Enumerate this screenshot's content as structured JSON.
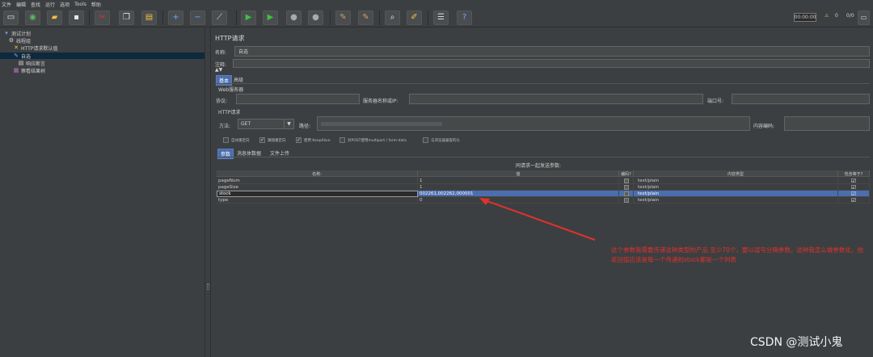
{
  "menu": [
    "文件",
    "编辑",
    "查找",
    "运行",
    "选项",
    "Tools",
    "帮助"
  ],
  "toolbar": {
    "buttons": [
      {
        "name": "new-icon",
        "glyph": "▭",
        "color": "#e8e8e8"
      },
      {
        "name": "templates-icon",
        "glyph": "◉",
        "color": "#5cb85c"
      },
      {
        "name": "open-icon",
        "glyph": "▰",
        "color": "#f0c040"
      },
      {
        "name": "save-icon",
        "glyph": "▪",
        "color": "#e8e8e8"
      },
      {
        "name": "cut-icon",
        "glyph": "✂",
        "color": "#e0322c"
      },
      {
        "name": "copy-icon",
        "glyph": "❐",
        "color": "#e8e8e8"
      },
      {
        "name": "paste-icon",
        "glyph": "▤",
        "color": "#f0c040"
      },
      {
        "name": "expand-icon",
        "glyph": "+",
        "color": "#6aa6ff"
      },
      {
        "name": "collapse-icon",
        "glyph": "−",
        "color": "#6aa6ff"
      },
      {
        "name": "toggle-icon",
        "glyph": "⟋",
        "color": "#dddddd"
      },
      {
        "name": "start-icon",
        "glyph": "▶",
        "color": "#3fbf3f"
      },
      {
        "name": "start-no-pause-icon",
        "glyph": "▶",
        "color": "#3fbf3f"
      },
      {
        "name": "stop-icon",
        "glyph": "●",
        "color": "#aaaaaa"
      },
      {
        "name": "shutdown-icon",
        "glyph": "●",
        "color": "#aaaaaa"
      },
      {
        "name": "clear-icon",
        "glyph": "✎",
        "color": "#d0a060"
      },
      {
        "name": "clear-all-icon",
        "glyph": "✎",
        "color": "#d0a060"
      },
      {
        "name": "search-icon",
        "glyph": "⌕",
        "color": "#e8e8e8"
      },
      {
        "name": "reset-search-icon",
        "glyph": "✐",
        "color": "#f0c040"
      },
      {
        "name": "function-helper-icon",
        "glyph": "☰",
        "color": "#dddddd"
      },
      {
        "name": "help-icon",
        "glyph": "?",
        "color": "#6aa6ff"
      }
    ],
    "timer": "00:00:00",
    "warnings": "0",
    "threads": "0/0"
  },
  "tree": [
    {
      "label": "测试计划",
      "icon": "test-plan-icon",
      "glyph": "▾",
      "indent": 0
    },
    {
      "label": "线程组",
      "icon": "thread-group-icon",
      "glyph": "⚙",
      "indent": 1
    },
    {
      "label": "HTTP请求默认值",
      "icon": "config-icon",
      "glyph": "✕",
      "indent": 2
    },
    {
      "label": "自选",
      "icon": "sampler-icon",
      "glyph": "✎",
      "indent": 2,
      "selected": true
    },
    {
      "label": "响应断言",
      "icon": "assertion-icon",
      "glyph": "▤",
      "indent": 3
    },
    {
      "label": "察看结果树",
      "icon": "listener-icon",
      "glyph": "▦",
      "indent": 2
    }
  ],
  "panel": {
    "title": "HTTP请求",
    "name_label": "名称:",
    "name_value": "自选",
    "comment_label": "注释:",
    "tabs": [
      "基本",
      "高级"
    ],
    "web_server_label": "Web服务器",
    "protocol_label": "协议:",
    "server_label": "服务器名称或IP:",
    "port_label": "端口号:",
    "http_request_label": "HTTP请求",
    "method_label": "方法:",
    "method_value": "GET",
    "path_label": "路径:",
    "encoding_label": "内容编码:",
    "options": [
      {
        "label": "自动重定向",
        "checked": false
      },
      {
        "label": "跟随重定向",
        "checked": true
      },
      {
        "label": "使用 KeepAlive",
        "checked": true
      },
      {
        "label": "对POST使用multipart / form-data",
        "checked": false
      },
      {
        "label": "与浏览器兼容的头",
        "checked": false
      }
    ],
    "subtabs": [
      "参数",
      "消息体数据",
      "文件上传"
    ],
    "params_caption": "同请求一起发送参数:",
    "columns": [
      "名称:",
      "值",
      "编码?",
      "内容类型",
      "包含等于?"
    ],
    "rows": [
      {
        "name": "pageNum",
        "value": "1",
        "encode": false,
        "content_type": "text/plain",
        "include_equals": true
      },
      {
        "name": "pageSize",
        "value": "1",
        "encode": false,
        "content_type": "text/plain",
        "include_equals": true
      },
      {
        "name": "stock",
        "value": "002261,002262,000001",
        "encode": false,
        "content_type": "text/plain",
        "include_equals": true,
        "selected": true
      },
      {
        "name": "type",
        "value": "0",
        "encode": false,
        "content_type": "text/plain",
        "include_equals": true
      }
    ]
  },
  "annotation": "这个参数我需要传递这种类型的产品 至少70个，要以逗号分隔参数，这种我怎么做参数化，他返回值应该是每一个传递的stock都是一个列表",
  "watermark": "CSDN @测试小鬼",
  "colors": {
    "selection": "#4b6eaf",
    "annotation": "#e0322c"
  }
}
